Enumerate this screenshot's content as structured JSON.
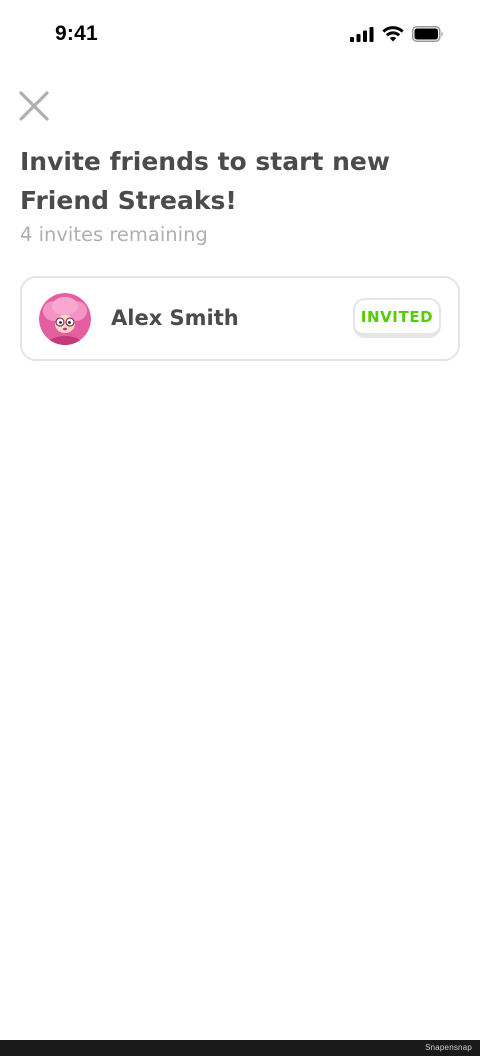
{
  "status_bar": {
    "time": "9:41",
    "icons": [
      "cellular-signal-icon",
      "wifi-icon",
      "battery-icon"
    ]
  },
  "header": {
    "close_icon": "close-icon",
    "title": "Invite friends to start new Friend Streaks!",
    "subtitle": "4 invites remaining"
  },
  "friends": [
    {
      "name": "Alex Smith",
      "avatar_icon": "character-avatar-icon",
      "button_label": "INVITED"
    }
  ],
  "colors": {
    "text_primary": "#4b4b4b",
    "text_secondary": "#afafaf",
    "border": "#e5e5e5",
    "invited_green": "#58cc02",
    "avatar_pink": "#e35fa0"
  },
  "footer": {
    "watermark": "Snapensnap"
  }
}
